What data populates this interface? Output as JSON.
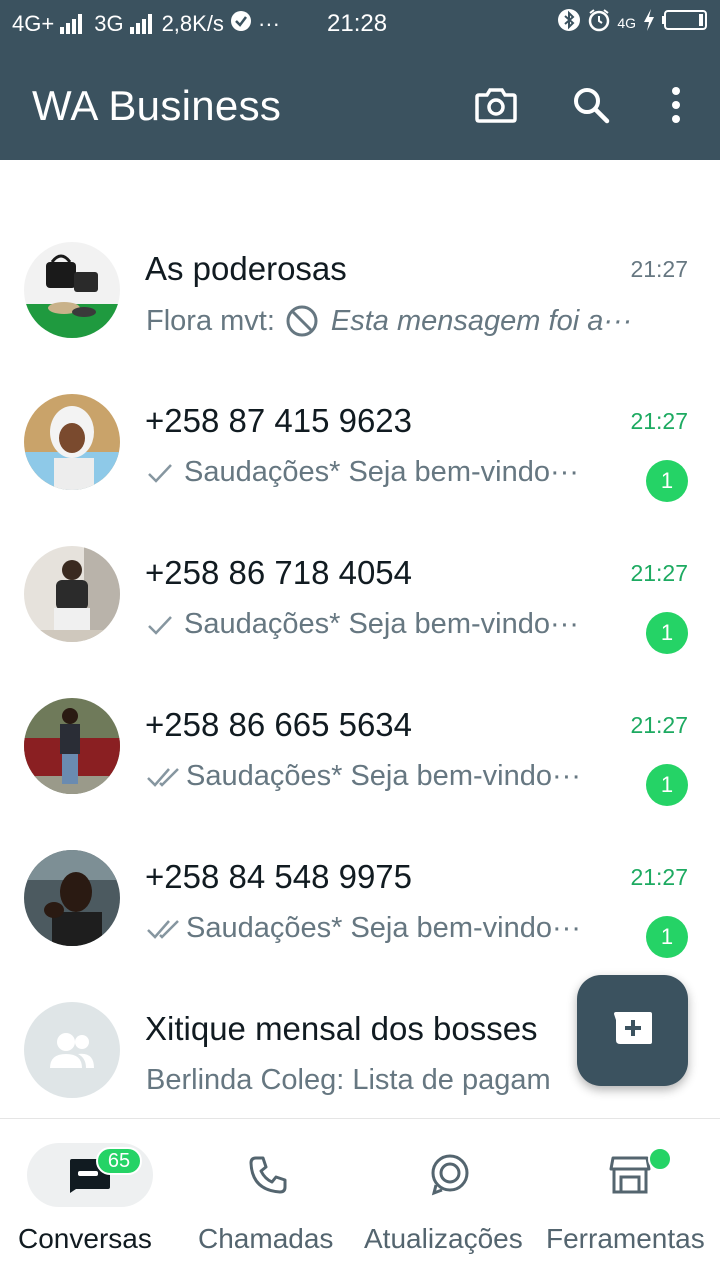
{
  "status_bar": {
    "network_1": "4G+",
    "network_2": "3G",
    "speed": "2,8K/s",
    "more": "···",
    "time": "21:28",
    "network_3": "4G"
  },
  "app_bar": {
    "title": "WA Business",
    "icons": [
      "camera-icon",
      "search-icon",
      "more-vert-icon"
    ]
  },
  "chats": [
    {
      "name": "As poderosas",
      "time": "21:27",
      "sender": "Flora mvt:",
      "preview": "Esta mensagem foi a···",
      "deleted": true,
      "unread": null
    },
    {
      "name": "+258 87 415 9623",
      "time": "21:27",
      "tick": "single",
      "preview": "Saudações*  Seja bem-vindo···",
      "unread": "1"
    },
    {
      "name": "+258 86 718 4054",
      "time": "21:27",
      "tick": "single",
      "preview": "Saudações*  Seja bem-vindo···",
      "unread": "1"
    },
    {
      "name": "+258 86 665 5634",
      "time": "21:27",
      "tick": "double",
      "preview": "Saudações*  Seja bem-vindo···",
      "unread": "1"
    },
    {
      "name": "+258 84 548 9975",
      "time": "21:27",
      "tick": "double",
      "preview": "Saudações*  Seja bem-vindo···",
      "unread": "1"
    },
    {
      "name": "Xitique mensal dos bosses",
      "preview": "Berlinda Coleg: Lista de pagam",
      "group": true
    }
  ],
  "bottom_nav": [
    {
      "label": "Conversas",
      "badge": "65",
      "active": true
    },
    {
      "label": "Chamadas"
    },
    {
      "label": "Atualizações"
    },
    {
      "label": "Ferramentas",
      "dot": true
    }
  ],
  "colors": {
    "header": "#3b525f",
    "accent_green": "#25d366",
    "time_green": "#1daa61",
    "secondary_text": "#667781"
  }
}
